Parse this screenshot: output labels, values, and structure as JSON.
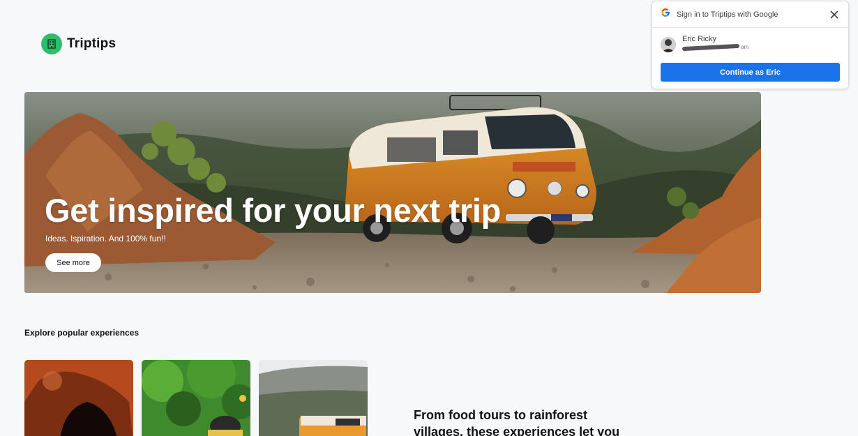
{
  "brand": {
    "name": "Triptips",
    "icon": "building-icon",
    "color": "#2bbf6a"
  },
  "hero": {
    "title": "Get inspired for your next trip",
    "subtitle": "Ideas. Ispiration. And 100% fun!!",
    "button_label": "See more"
  },
  "section": {
    "title": "Explore popular experiences",
    "cards": [
      {
        "icon": "cave-photo"
      },
      {
        "icon": "rainforest-photo"
      },
      {
        "icon": "campervan-photo"
      }
    ],
    "promo_text": "From food tours to rainforest villages, these experiences let you"
  },
  "google_signin": {
    "title": "Sign in to Triptips with Google",
    "account_name": "Eric Ricky",
    "account_email_suffix": "om",
    "continue_label": "Continue as Eric",
    "button_color": "#1a73e8"
  }
}
